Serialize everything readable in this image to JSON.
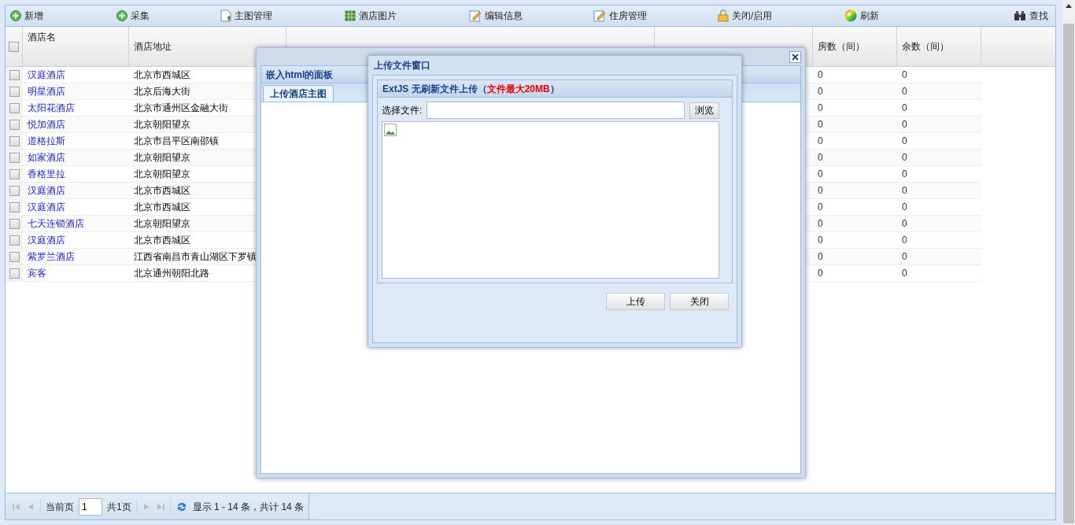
{
  "toolbar": [
    {
      "label": "新增"
    },
    {
      "label": "采集"
    },
    {
      "label": "主图管理"
    },
    {
      "label": "酒店图片"
    },
    {
      "label": "编辑信息"
    },
    {
      "label": "住房管理"
    },
    {
      "label": "关闭/启用"
    },
    {
      "label": "刷新"
    },
    {
      "label": "查找"
    }
  ],
  "table": {
    "select_all_checked": false,
    "columns": [
      "酒店名",
      "酒店地址",
      "",
      "",
      "房数（间）",
      "余数（间）"
    ],
    "rows": [
      {
        "checked": false,
        "name": "汉庭酒店",
        "address": "北京市西城区",
        "rooms": "0",
        "remaining": "0"
      },
      {
        "checked": false,
        "name": "明星酒店",
        "address": "北京后海大街",
        "rooms": "0",
        "remaining": "0"
      },
      {
        "checked": false,
        "name": "太阳花酒店",
        "address": "北京市通州区金融大街",
        "rooms": "0",
        "remaining": "0"
      },
      {
        "checked": false,
        "name": "悦加酒店",
        "address": "北京朝阳望京",
        "rooms": "0",
        "remaining": "0"
      },
      {
        "checked": false,
        "name": "道格拉斯",
        "address": "北京市昌平区南邵镇",
        "rooms": "0",
        "remaining": "0"
      },
      {
        "checked": false,
        "name": "如家酒店",
        "address": "北京朝阳望京",
        "rooms": "0",
        "remaining": "0"
      },
      {
        "checked": false,
        "name": "香格里拉",
        "address": "北京朝阳望京",
        "rooms": "0",
        "remaining": "0"
      },
      {
        "checked": false,
        "name": "汉庭酒店",
        "address": "北京市西城区",
        "rooms": "0",
        "remaining": "0"
      },
      {
        "checked": false,
        "name": "汉庭酒店",
        "address": "北京市西城区",
        "rooms": "0",
        "remaining": "0"
      },
      {
        "checked": false,
        "name": "七天连锁酒店",
        "address": "北京朝阳望京",
        "rooms": "0",
        "remaining": "0"
      },
      {
        "checked": false,
        "name": "汉庭酒店",
        "address": "北京市西城区",
        "rooms": "0",
        "remaining": "0"
      },
      {
        "checked": false,
        "name": "紫罗兰酒店",
        "address": "江西省南昌市青山湖区下罗镇",
        "rooms": "0",
        "remaining": "0"
      },
      {
        "checked": false,
        "name": "宾客",
        "address": "北京通州朝阳北路",
        "rooms": "0",
        "remaining": "0"
      }
    ]
  },
  "pager": {
    "page_label": "当前页",
    "page": "1",
    "total_pages": "共1页",
    "summary": "显示 1 - 14 条，共计 14 条"
  },
  "outer_window": {
    "panel_title": "嵌入html的面板",
    "tabs": [
      {
        "label": "上传酒店主图",
        "selected": true
      }
    ]
  },
  "upload_window": {
    "title": "上传文件窗口",
    "panel_title": "ExtJS 无刷新文件上传（",
    "panel_title_highlight": "文件最大20MB",
    "panel_title_end": "）",
    "file_label": "选择文件:",
    "browse": "浏览",
    "buttons": [
      "上传",
      "关闭"
    ]
  }
}
